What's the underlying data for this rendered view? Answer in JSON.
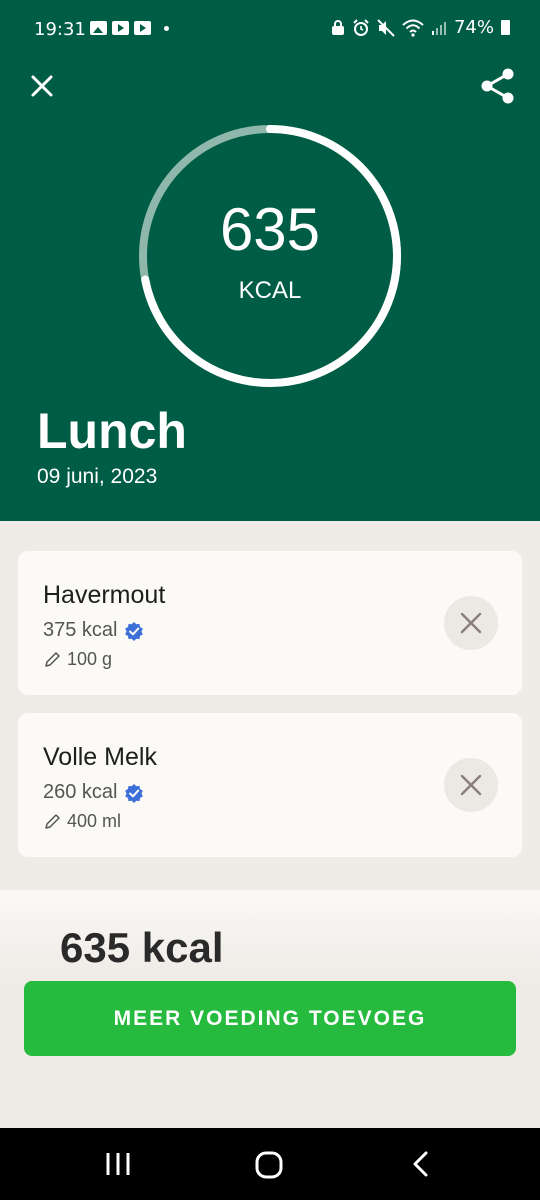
{
  "status_bar": {
    "time": "19:31",
    "battery": "74%"
  },
  "header": {
    "close_icon": "close-icon",
    "share_icon": "share-icon",
    "kcal_value": "635",
    "kcal_unit": "KCAL",
    "ring_progress": 0.72,
    "meal_title": "Lunch",
    "meal_date": "09 juni, 2023"
  },
  "items": [
    {
      "name": "Havermout",
      "kcal": "375 kcal",
      "amount": "100 g"
    },
    {
      "name": "Volle Melk",
      "kcal": "260 kcal",
      "amount": "400 ml"
    }
  ],
  "summary": {
    "total": "635 kcal"
  },
  "add_button": {
    "label": "MEER VOEDING TOEVOEG"
  },
  "colors": {
    "header_bg": "#005d45",
    "button_green": "#26bb3f",
    "verified_blue": "#3d6fd8"
  }
}
